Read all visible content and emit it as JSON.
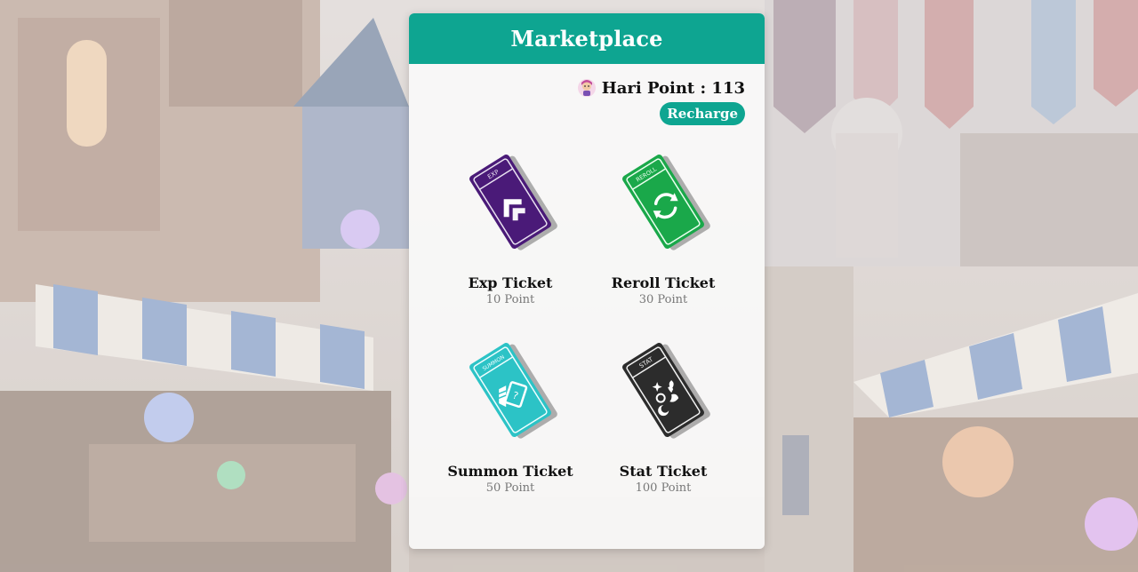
{
  "header": {
    "title": "Marketplace"
  },
  "user": {
    "points_text": "Hari Point : 113",
    "avatar_icon": "avatar-icon"
  },
  "actions": {
    "recharge_label": "Recharge"
  },
  "tickets": [
    {
      "name": "Exp Ticket",
      "price": "10 Point",
      "tag": "EXP",
      "color": "#4a1a78",
      "icon": "double-chevron-icon"
    },
    {
      "name": "Reroll Ticket",
      "price": "30 Point",
      "tag": "REROLL",
      "color": "#1aa84a",
      "icon": "refresh-icon"
    },
    {
      "name": "Summon Ticket",
      "price": "50 Point",
      "tag": "SUMMON",
      "color": "#2cc3c6",
      "icon": "summon-cards-icon"
    },
    {
      "name": "Stat Ticket",
      "price": "100 Point",
      "tag": "STAT",
      "color": "#2c2c2c",
      "icon": "stat-symbols-icon"
    }
  ],
  "colors": {
    "accent": "#0ea591"
  }
}
